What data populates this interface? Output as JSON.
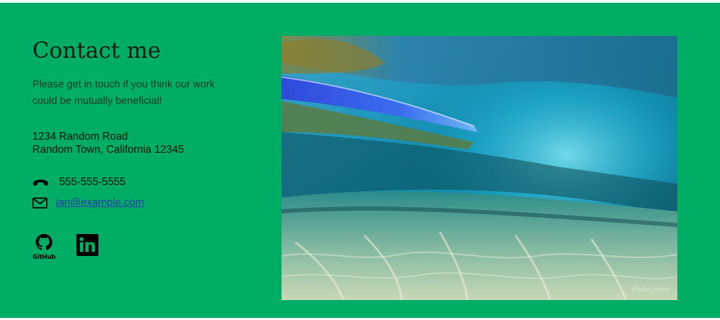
{
  "contact": {
    "title": "Contact me",
    "intro": "Please get in touch if you think our work could be mutually beneficial!",
    "address_line1": "1234 Random Road",
    "address_line2": "Random Town, California 12345",
    "phone": "555-555-5555",
    "email": "ian@example.com"
  },
  "socials": {
    "github_label": "GitHub",
    "linkedin_icon": "linkedin-icon"
  },
  "photo": {
    "subject": "underwater view of a breaking wave over sandy seabed",
    "watermark": "Photo Jones"
  },
  "colors": {
    "section_background": "#00ad64",
    "link": "#2a3aa8",
    "text": "#06140c"
  }
}
